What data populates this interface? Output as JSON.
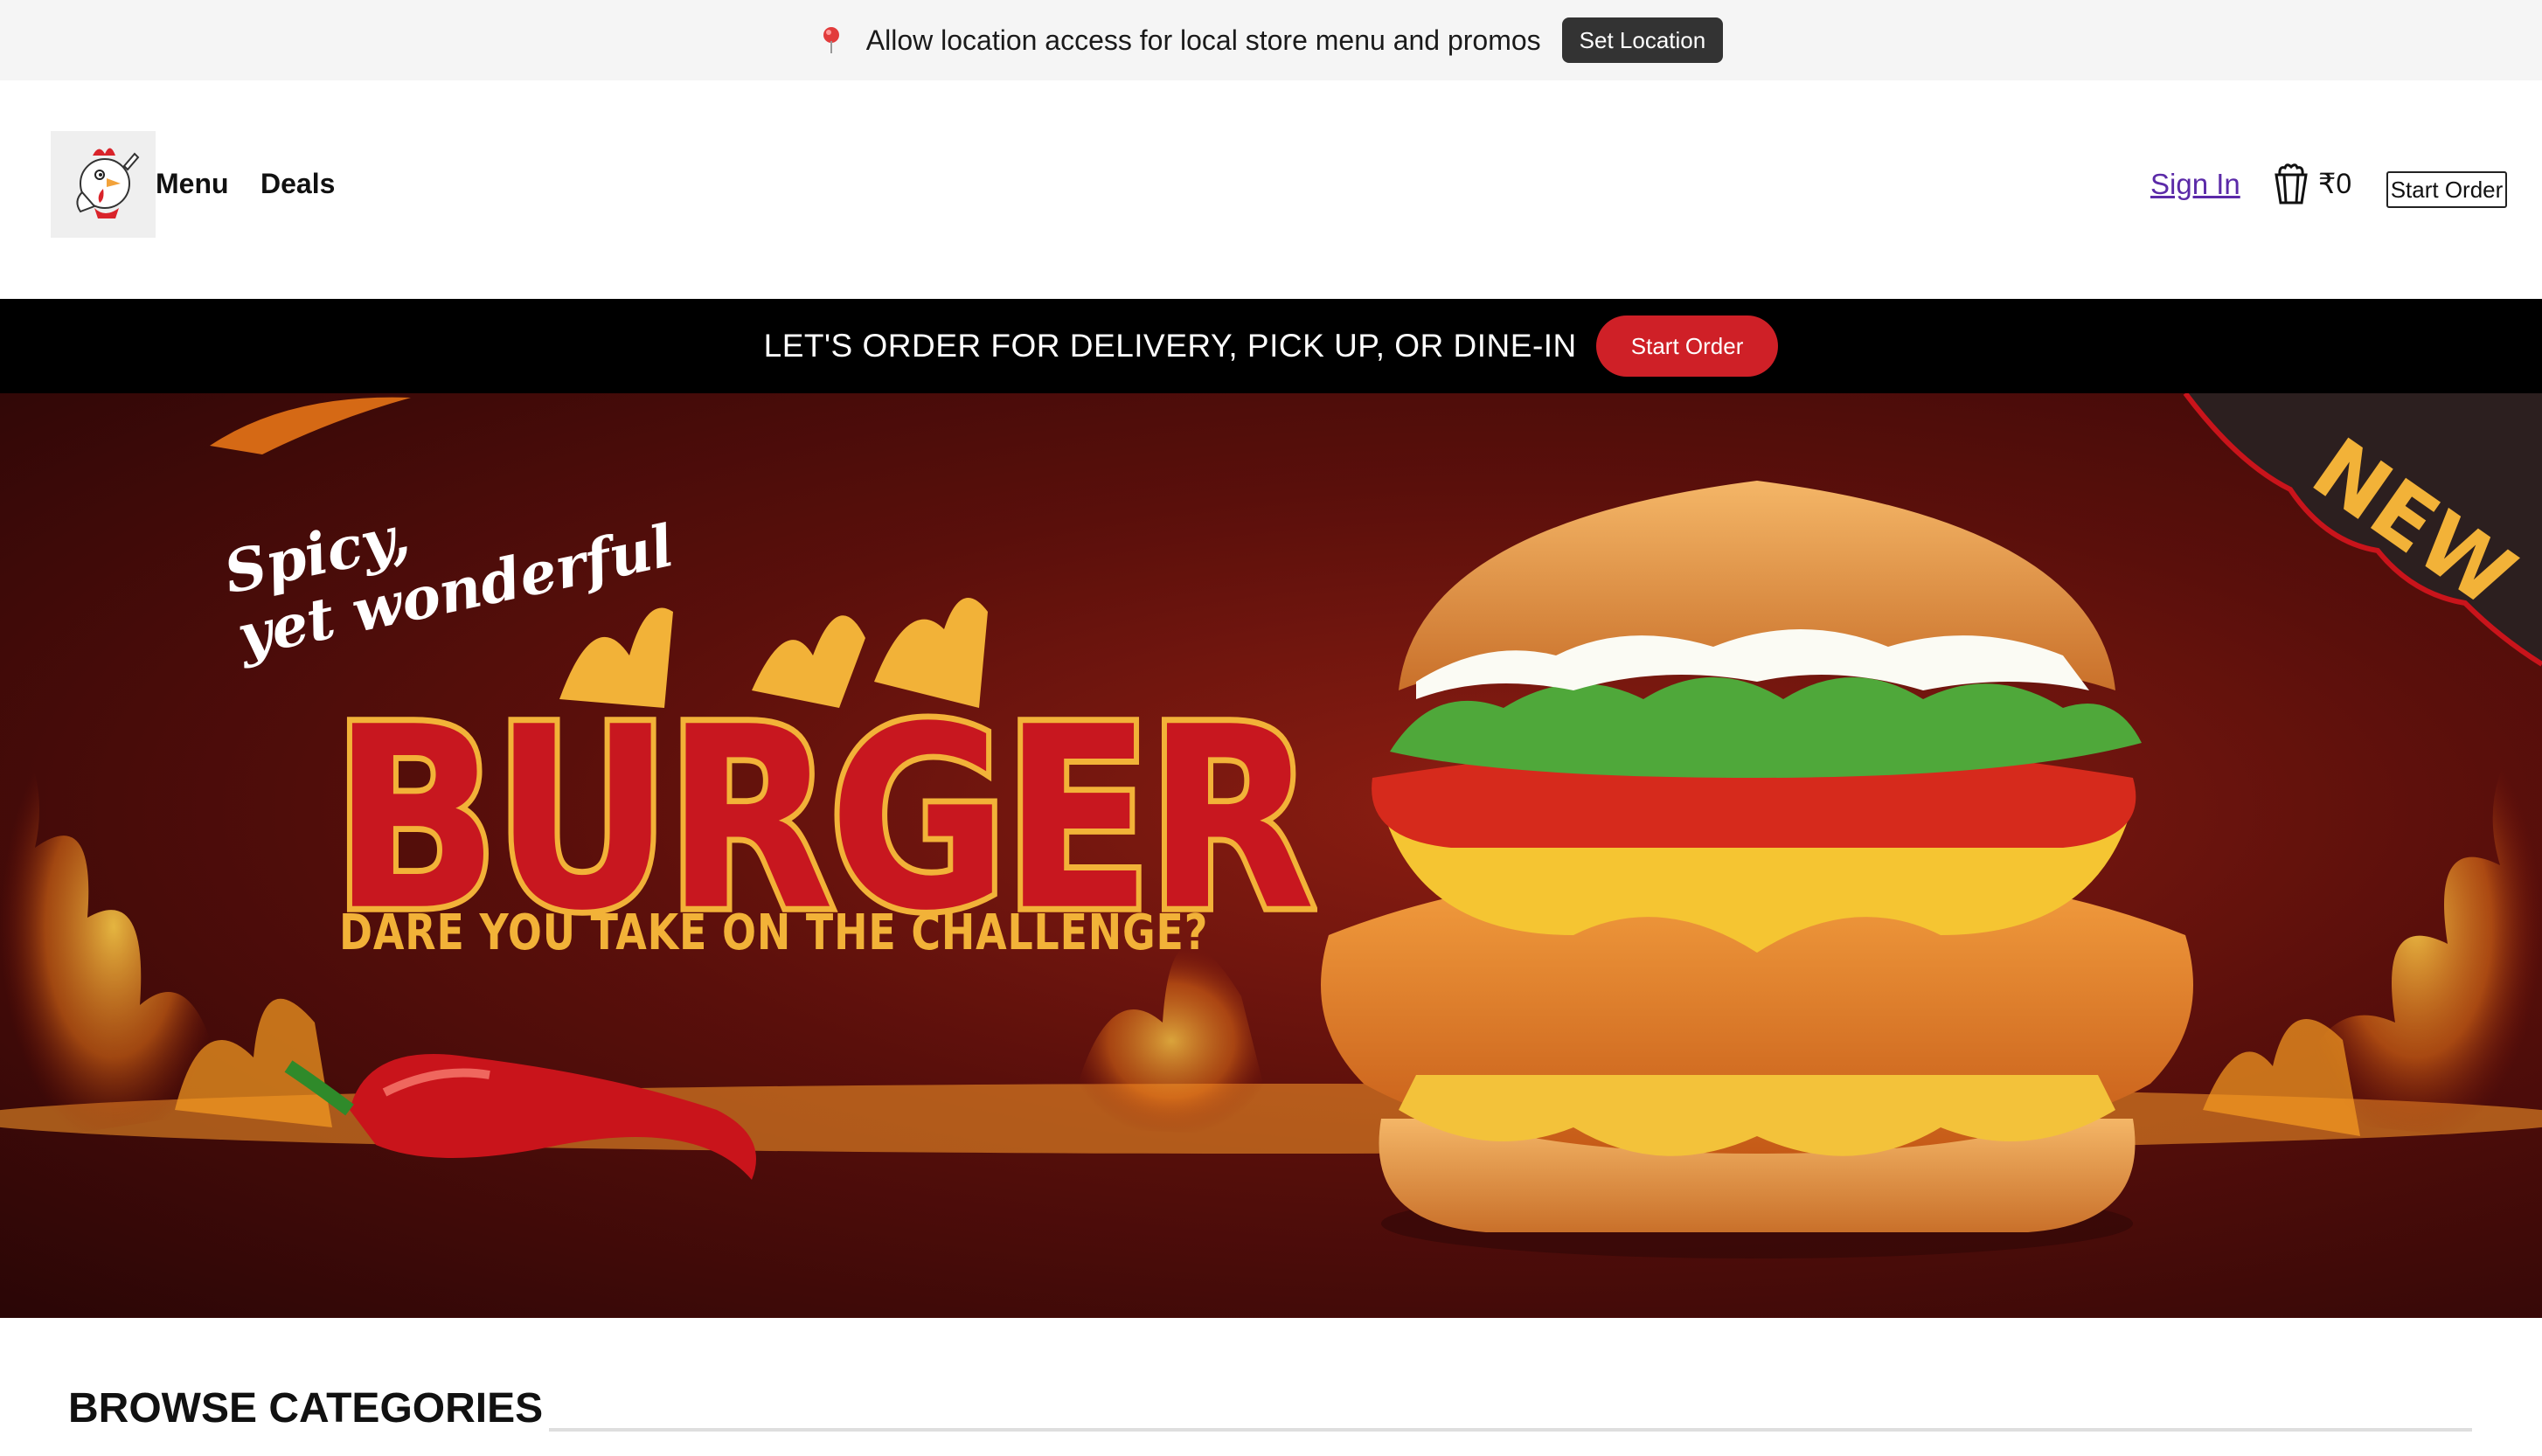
{
  "location_bar": {
    "icon": "location-pin-icon",
    "message": "Allow location access for local store menu and promos",
    "button_label": "Set Location"
  },
  "header": {
    "logo_icon": "rooster-mascot-logo",
    "nav": [
      {
        "label": "Menu"
      },
      {
        "label": "Deals"
      }
    ],
    "sign_in_label": "Sign In",
    "cart_icon": "bucket-icon",
    "cart_total": "₹0",
    "start_order_label": "Start Order"
  },
  "order_strip": {
    "text": "LET'S ORDER FOR DELIVERY, PICK UP, OR DINE-IN",
    "button_label": "Start Order",
    "button_color": "#cf2027"
  },
  "hero_banner": {
    "script_line_1": "Spicy,",
    "script_line_2": "yet wonderful",
    "headline": "BURGER",
    "tagline": "DARE YOU TAKE ON THE CHALLENGE?",
    "badge": "NEW"
  },
  "browse": {
    "heading": "BROWSE CATEGORIES"
  },
  "colors": {
    "accent_red": "#cf2027",
    "strip_bg": "#000000",
    "link_purple": "#5b2aa8",
    "banner_gold": "#f2b238"
  }
}
